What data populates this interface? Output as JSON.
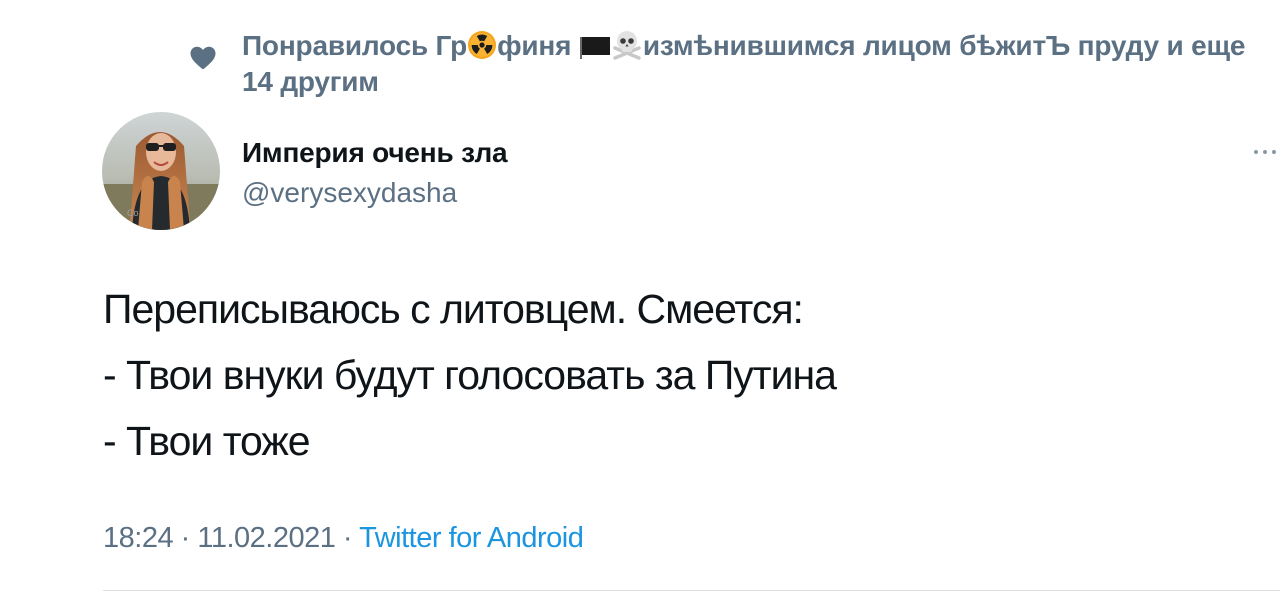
{
  "social_context": {
    "prefix": "Понравилось Гр",
    "middle": "финя ",
    "suffix": "измѣнившимся лицом бѣжитЪ пруду и еще 14 другим",
    "icons": [
      "heart-icon",
      "radioactive-emoji",
      "black-flag-emoji",
      "skull-crossbones-emoji"
    ]
  },
  "author": {
    "display_name": "Империя очень зла",
    "handle": "@verysexydasha"
  },
  "tweet": {
    "lines": [
      "Переписываюсь с литовцем. Смеется:",
      "- Твои внуки будут голосовать за Путина",
      "- Твои тоже"
    ]
  },
  "meta": {
    "time": "18:24",
    "separator": " · ",
    "date": "11.02.2021",
    "source": "Twitter for Android"
  },
  "colors": {
    "secondary_text": "#5b7083",
    "link": "#1b95e0",
    "primary_text": "#0f1419",
    "divider": "#d9dfe3"
  }
}
